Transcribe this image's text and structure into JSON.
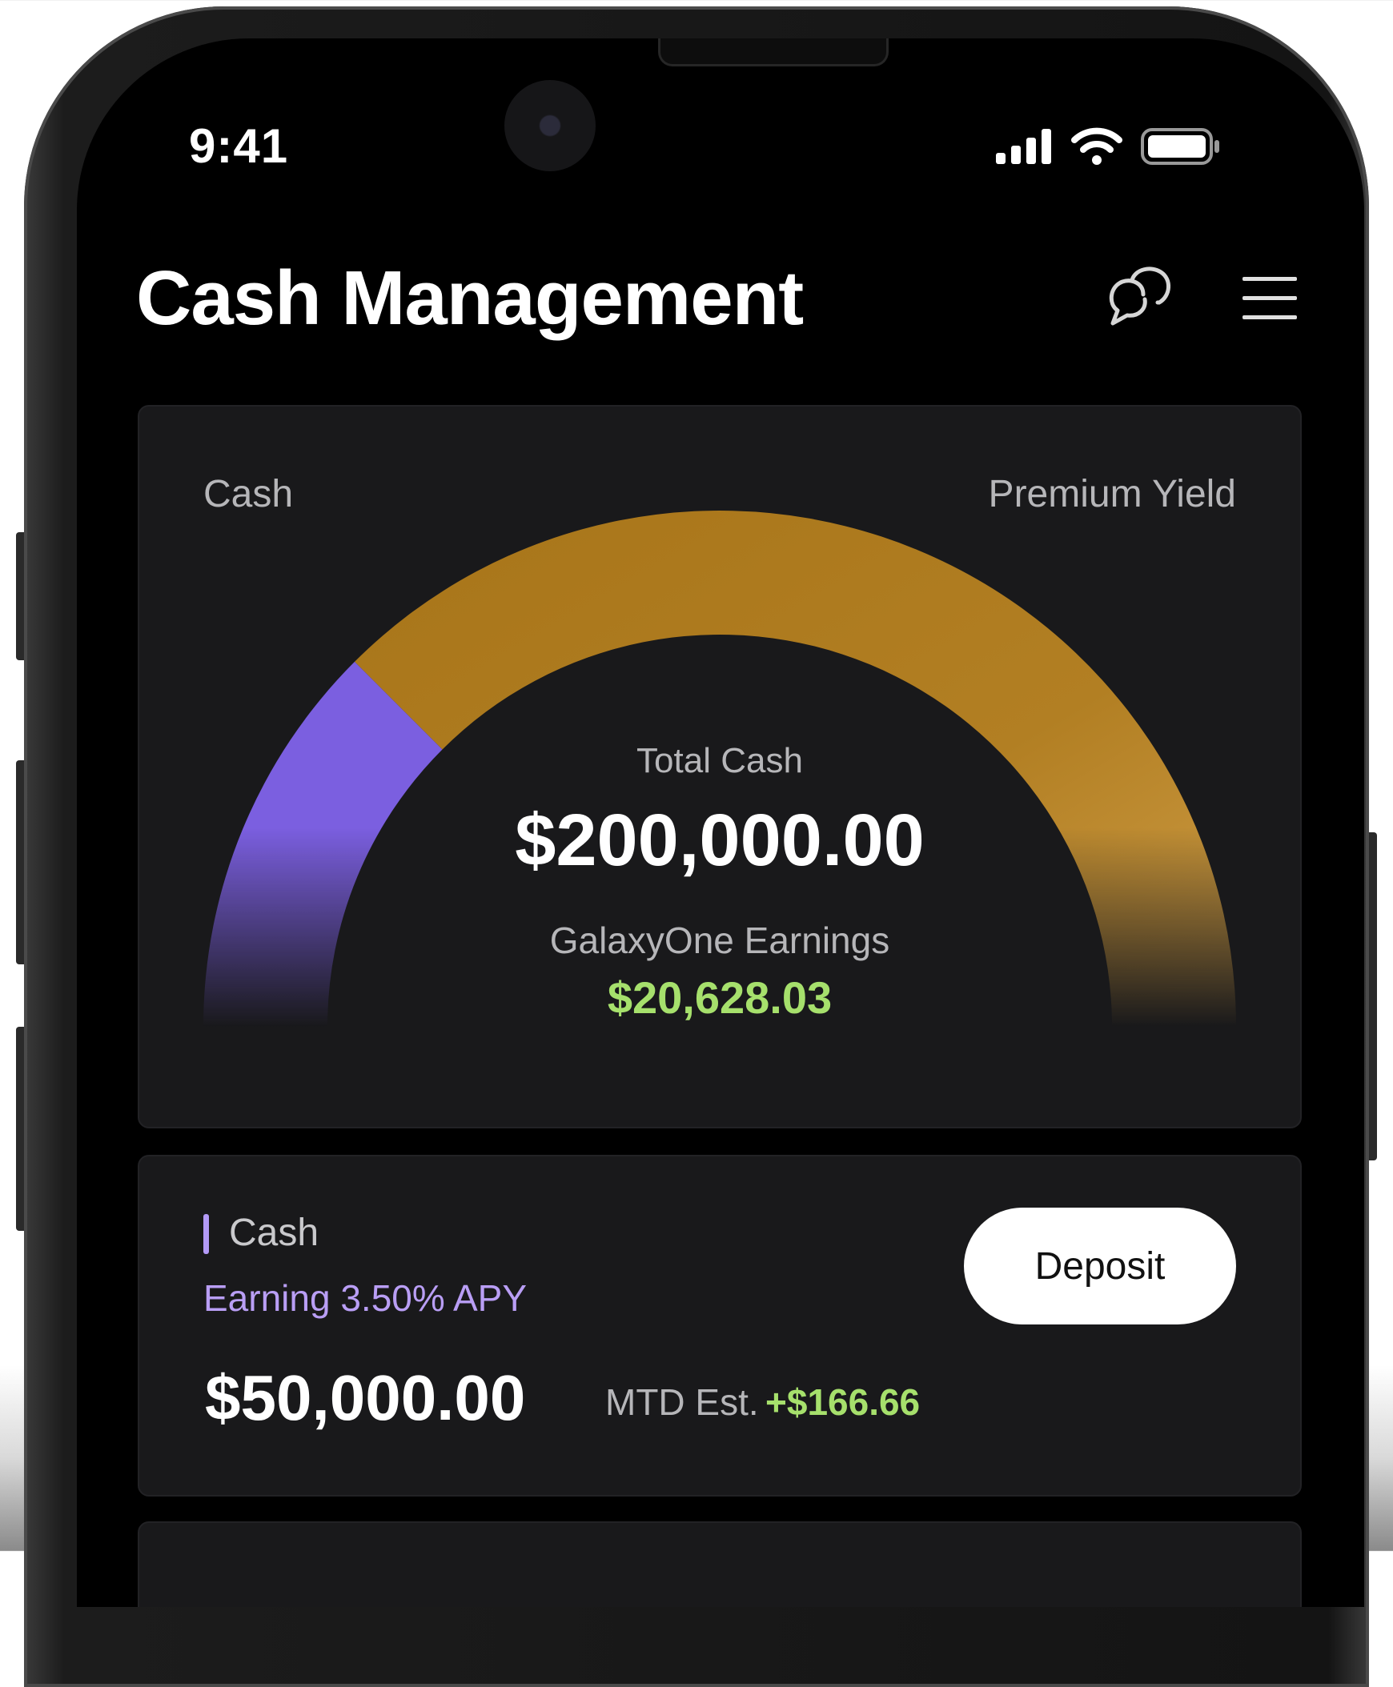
{
  "status_bar": {
    "time": "9:41",
    "icons": [
      "cellular-signal-icon",
      "wifi-icon",
      "battery-icon"
    ]
  },
  "header": {
    "title": "Cash Management",
    "actions": [
      "chat-icon",
      "hamburger-menu-icon"
    ]
  },
  "allocation_card": {
    "left_label": "Cash",
    "right_label": "Premium Yield",
    "total_label": "Total Cash",
    "total_value": "$200,000.00",
    "earnings_label": "GalaxyOne Earnings",
    "earnings_value": "$20,628.03",
    "segments": [
      {
        "name": "Cash",
        "fraction": 0.25,
        "color": "#7b5fe0"
      },
      {
        "name": "Premium Yield",
        "fraction": 0.75,
        "color": "#b07d22"
      }
    ]
  },
  "cash_card": {
    "title": "Cash",
    "apy_text": "Earning 3.50% APY",
    "balance": "$50,000.00",
    "mtd_label": "MTD Est.",
    "mtd_value": "+$166.66",
    "deposit_label": "Deposit"
  },
  "colors": {
    "background": "#000000",
    "card": "#19191b",
    "accent_purple": "#b39af7",
    "gain_green": "#a6e06c",
    "gold": "#b07d22"
  }
}
